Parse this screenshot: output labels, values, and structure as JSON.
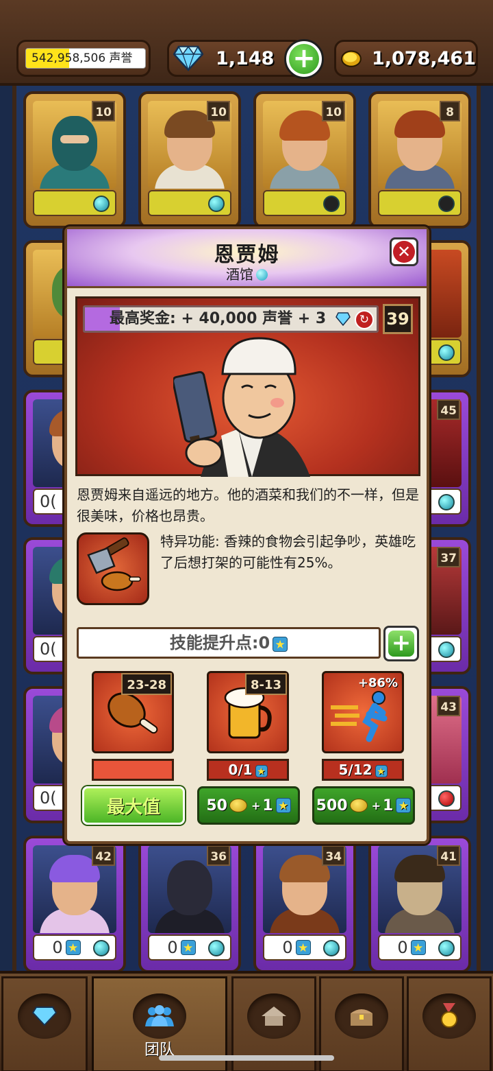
{
  "topbar": {
    "fame_value": "542,958,506 声誉",
    "fame_progress": 0.36,
    "gems": "1,148",
    "gold": "1,078,461"
  },
  "cards": [
    {
      "level": "10",
      "bar": "",
      "dot": "cyan",
      "frame": "gold"
    },
    {
      "level": "10",
      "bar": "",
      "dot": "cyan",
      "frame": "gold"
    },
    {
      "level": "10",
      "bar": "",
      "dot": "dark",
      "frame": "gold"
    },
    {
      "level": "8",
      "bar": "",
      "dot": "dark",
      "frame": "gold"
    },
    {
      "level": "42",
      "bar": "0",
      "dot": "cyan",
      "frame": "purple"
    },
    {
      "level": "36",
      "bar": "0",
      "dot": "cyan",
      "frame": "purple"
    },
    {
      "level": "34",
      "bar": "0",
      "dot": "cyan",
      "frame": "purple"
    },
    {
      "level": "41",
      "bar": "0",
      "dot": "cyan",
      "frame": "purple"
    }
  ],
  "side_cards": {
    "left_values": [
      "0(",
      "0(",
      "0("
    ],
    "right_levels": [
      "45",
      "37",
      "43"
    ]
  },
  "modal": {
    "title": "恩贾姆",
    "subtitle": "酒馆",
    "bonus_text": "最高奖金: + 40,000 声誉 + 3",
    "bonus_progress": 0.12,
    "level": "39",
    "description": "恩贾姆来自遥远的地方。他的酒菜和我们的不一样，但是很美味，价格也昂贵。",
    "special": "特异功能: 香辣的食物会引起争吵，英雄吃了后想打架的可能性有25%。",
    "skill_points": "技能提升点:0",
    "upgrades": [
      {
        "badge": "23-28",
        "progress": "",
        "button": "最大值",
        "icon": "chicken-leg-icon"
      },
      {
        "badge": "8-13",
        "progress": "0/1",
        "button_cost": "50",
        "button_stars": "1",
        "icon": "beer-mug-icon"
      },
      {
        "badge": "+86%",
        "progress": "5/12",
        "button_cost": "500",
        "button_stars": "1",
        "icon": "running-man-icon"
      }
    ]
  },
  "nav": {
    "tabs": [
      "",
      "团队",
      "",
      "",
      ""
    ],
    "active": 1
  },
  "colors": {
    "accent_green": "#4cb526",
    "modal_bg": "#efe6d2",
    "purple_frame": "#9a4ad8",
    "gold_frame": "#d8a548"
  }
}
